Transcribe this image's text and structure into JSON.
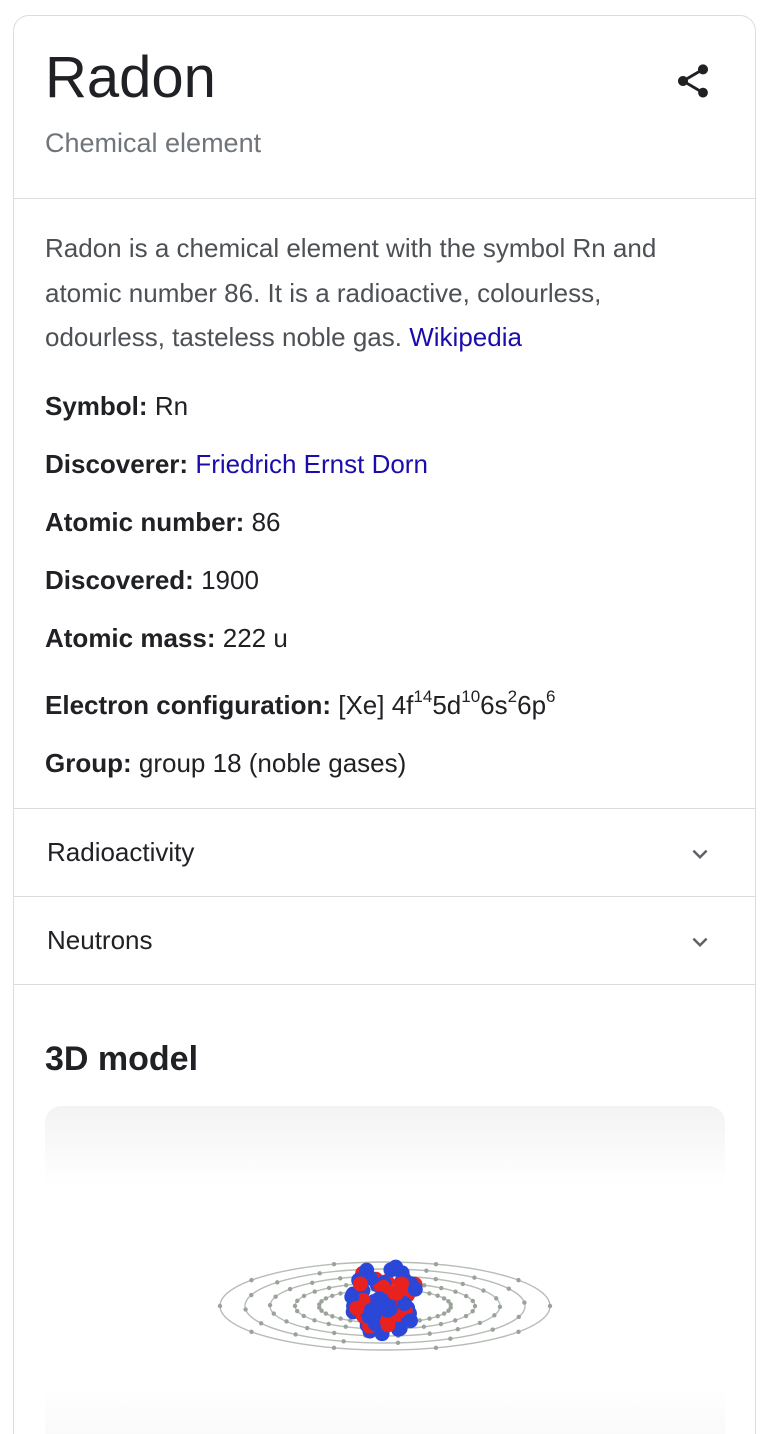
{
  "header": {
    "title": "Radon",
    "subtitle": "Chemical element",
    "share_icon": "share-icon"
  },
  "description": {
    "text": "Radon is a chemical element with the symbol Rn and atomic number 86. It is a radioactive, colourless, odourless, tasteless noble gas.",
    "source_link": "Wikipedia"
  },
  "facts": {
    "symbol": {
      "label": "Symbol:",
      "value": "Rn"
    },
    "discoverer": {
      "label": "Discoverer:",
      "value": "Friedrich Ernst Dorn"
    },
    "atomic_number": {
      "label": "Atomic number:",
      "value": "86"
    },
    "discovered": {
      "label": "Discovered:",
      "value": "1900"
    },
    "atomic_mass": {
      "label": "Atomic mass:",
      "value": "222 u"
    },
    "electron_configuration": {
      "label": "Electron configuration:",
      "prefix": "[Xe] ",
      "terms": [
        {
          "orbital": "4f",
          "count": "14"
        },
        {
          "orbital": "5d",
          "count": "10"
        },
        {
          "orbital": "6s",
          "count": "2"
        },
        {
          "orbital": "6p",
          "count": "6"
        }
      ]
    },
    "group": {
      "label": "Group:",
      "value": "group 18 (noble gases)"
    }
  },
  "accordions": [
    {
      "label": "Radioactivity",
      "icon": "chevron-down-icon"
    },
    {
      "label": "Neutrons",
      "icon": "chevron-down-icon"
    }
  ],
  "model": {
    "title": "3D model",
    "colors": {
      "proton": "#e8231f",
      "neutron": "#2b47d8",
      "electron_shell": "#b7bcb7"
    }
  }
}
